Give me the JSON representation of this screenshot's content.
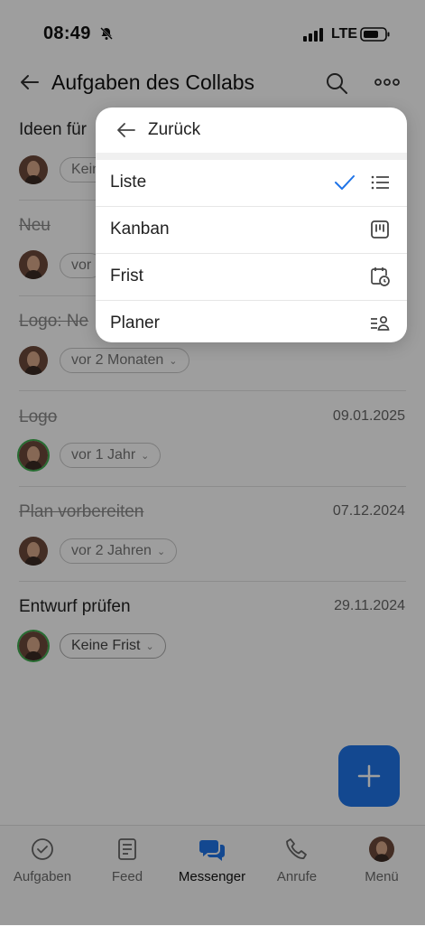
{
  "status": {
    "time": "08:49",
    "network": "LTE"
  },
  "header": {
    "title": "Aufgaben des Collabs"
  },
  "tasks": [
    {
      "title": "Ideen für",
      "date": "",
      "chip": "Keine Frist",
      "done": false
    },
    {
      "title": "Neu",
      "date": "",
      "chip": "vor",
      "done": true
    },
    {
      "title": "Logo: Ne",
      "date": "",
      "chip": "vor 2 Monaten",
      "done": true
    },
    {
      "title": "Logo",
      "date": "09.01.2025",
      "chip": "vor 1 Jahr",
      "done": true
    },
    {
      "title": "Plan vorbereiten",
      "date": "07.12.2024",
      "chip": "vor 2 Jahren",
      "done": true
    },
    {
      "title": "Entwurf prüfen",
      "date": "29.11.2024",
      "chip": "Keine Frist",
      "done": false
    }
  ],
  "menu": {
    "back_label": "Zurück",
    "items": [
      {
        "label": "Liste",
        "icon": "list-icon",
        "selected": true
      },
      {
        "label": "Kanban",
        "icon": "kanban-icon",
        "selected": false
      },
      {
        "label": "Frist",
        "icon": "calendar-clock-icon",
        "selected": false
      },
      {
        "label": "Planer",
        "icon": "planner-icon",
        "selected": false
      }
    ]
  },
  "nav": [
    {
      "label": "Aufgaben",
      "icon": "check-circle-icon"
    },
    {
      "label": "Feed",
      "icon": "feed-icon"
    },
    {
      "label": "Messenger",
      "icon": "chat-icon",
      "active": true
    },
    {
      "label": "Anrufe",
      "icon": "phone-icon"
    },
    {
      "label": "Menü",
      "icon": "avatar-icon"
    }
  ],
  "colors": {
    "accent": "#1f74e8",
    "check": "#1f74e8",
    "avatar_ring": "#3fae50"
  }
}
